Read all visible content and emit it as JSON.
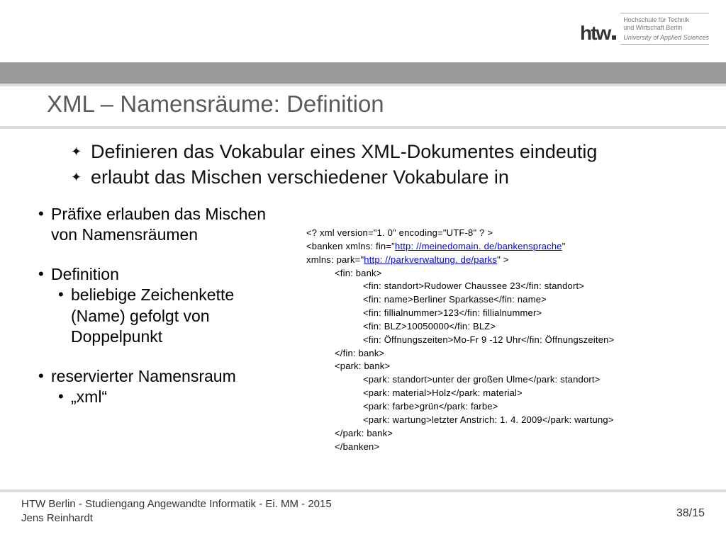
{
  "logo": {
    "letters": "htw",
    "line1": "Hochschule für Technik",
    "line2": "und Wirtschaft Berlin",
    "line3": "University of Applied Sciences"
  },
  "header": {
    "title": "XML – Namensräume: Definition"
  },
  "backBullets": [
    "Definieren das Vokabular eines XML-Dokumentes eindeutig",
    "erlaubt das Mischen verschiedener Vokabulare in"
  ],
  "left": {
    "b1": "Präfixe erlauben das Mischen von Namensräumen",
    "b2": "Definition",
    "b2sub": "beliebige Zeichenkette (Name) gefolgt von Doppelpunkt",
    "b3": "reservierter Namensraum",
    "b3sub": "„xml“"
  },
  "code": {
    "l0": "<? xml version=\"1. 0\" encoding=\"UTF-8\" ? >",
    "l1a": "<banken xmlns: fin=\"",
    "l1link": "http: //meinedomain. de/bankensprache",
    "l1b": "\"",
    "l2a": "xmlns: park=\"",
    "l2link": "http: //parkverwaltung. de/parks",
    "l2b": "\" >",
    "l3": "<fin: bank>",
    "l4": "<fin: standort>Rudower Chaussee 23</fin: standort>",
    "l5": "<fin: name>Berliner Sparkasse</fin: name>",
    "l6": "<fin: fillialnummer>123</fin: fillialnummer>",
    "l7": "<fin: BLZ>10050000</fin: BLZ>",
    "l8": "<fin: Öffnungszeiten>Mo-Fr 9 -12 Uhr</fin: Öffnungszeiten>",
    "l9": "</fin: bank>",
    "l10": "<park: bank>",
    "l11": "<park: standort>unter der großen Ulme</park: standort>",
    "l12": "<park: material>Holz</park: material>",
    "l13": "<park: farbe>grün</park: farbe>",
    "l14": "<park: wartung>letzter Anstrich: 1. 4. 2009</park: wartung>",
    "l15": "</park: bank>",
    "l16": "</banken>"
  },
  "footer": {
    "left1": "HTW Berlin - Studiengang Angewandte Informatik - Ei. MM - 2015",
    "left2": "Jens Reinhardt",
    "page": "38/15"
  }
}
